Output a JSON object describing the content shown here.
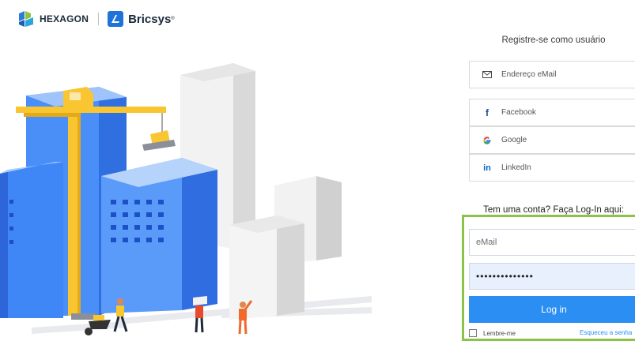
{
  "header": {
    "hexagon_label": "HEXAGON",
    "bricsys_label": "Bricsys",
    "bricsys_reg": "®"
  },
  "register": {
    "title": "Registre-se como usuário",
    "email_option": "Endereço eMail",
    "facebook": "Facebook",
    "google": "Google",
    "linkedin": "LinkedIn"
  },
  "login": {
    "title": "Tem uma conta? Faça Log-In aqui:",
    "email_placeholder": "eMail",
    "password_mask": "••••••••••••••",
    "button_label": "Log in",
    "remember_label": "Lembre-me",
    "forgot_label": "Esqueceu a senha"
  },
  "colors": {
    "accent": "#2b8ef2",
    "highlight_border": "#8bc34a",
    "building_blue": "#3a82f7",
    "crane_yellow": "#f9c531"
  },
  "icons": [
    "hexagon-logo-icon",
    "bricsys-logo-icon",
    "envelope-icon",
    "facebook-icon",
    "google-icon",
    "linkedin-icon"
  ]
}
